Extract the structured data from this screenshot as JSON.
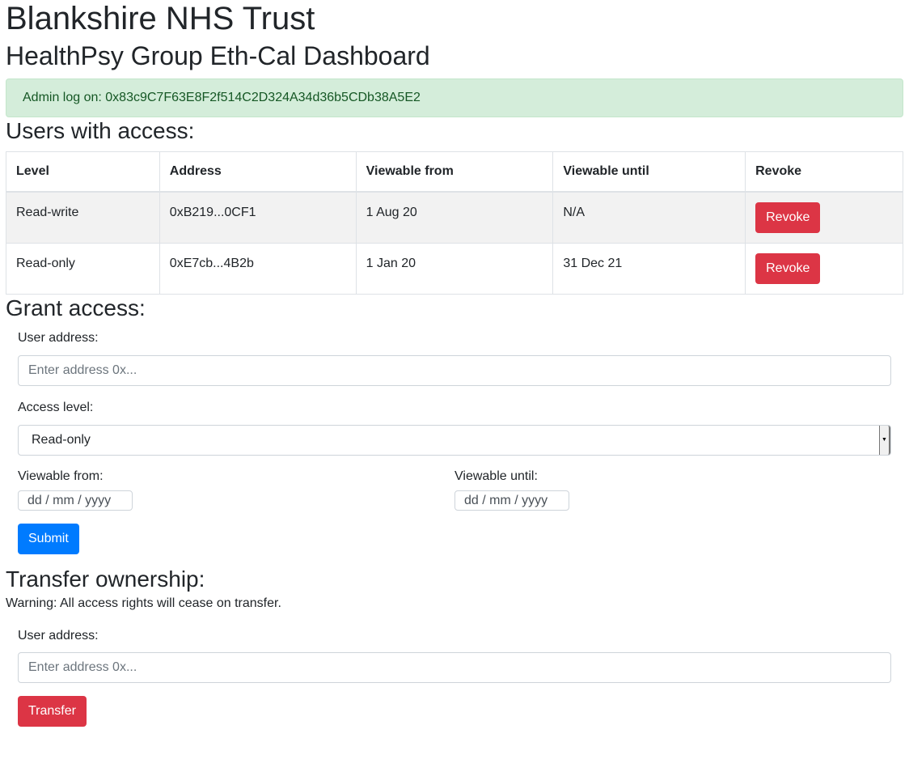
{
  "header": {
    "org_title": "Blankshire NHS Trust",
    "dashboard_title": "HealthPsy Group Eth-Cal Dashboard"
  },
  "alert": {
    "text": "Admin log on: 0x83c9C7F63E8F2f514C2D324A34d36b5CDb38A5E2",
    "bg_color": "#d4edda",
    "text_color": "#155724"
  },
  "users_section": {
    "title": "Users with access:",
    "columns": [
      "Level",
      "Address",
      "Viewable from",
      "Viewable until",
      "Revoke"
    ],
    "rows": [
      {
        "level": "Read-write",
        "address": "0xB219...0CF1",
        "from": "1 Aug 20",
        "until": "N/A",
        "action": "Revoke"
      },
      {
        "level": "Read-only",
        "address": "0xE7cb...4B2b",
        "from": "1 Jan 20",
        "until": "31 Dec 21",
        "action": "Revoke"
      }
    ]
  },
  "grant_section": {
    "title": "Grant access:",
    "user_address_label": "User address:",
    "user_address_placeholder": "Enter address 0x...",
    "access_level_label": "Access level:",
    "access_level_value": "Read-only",
    "viewable_from_label": "Viewable from:",
    "viewable_until_label": "Viewable until:",
    "date_placeholder": "dd / mm / yyyy",
    "submit_label": "Submit"
  },
  "transfer_section": {
    "title": "Transfer ownership:",
    "warning": "Warning: All access rights will cease on transfer.",
    "user_address_label": "User address:",
    "user_address_placeholder": "Enter address 0x...",
    "transfer_label": "Transfer"
  },
  "colors": {
    "danger": "#dc3545",
    "primary": "#007bff"
  }
}
